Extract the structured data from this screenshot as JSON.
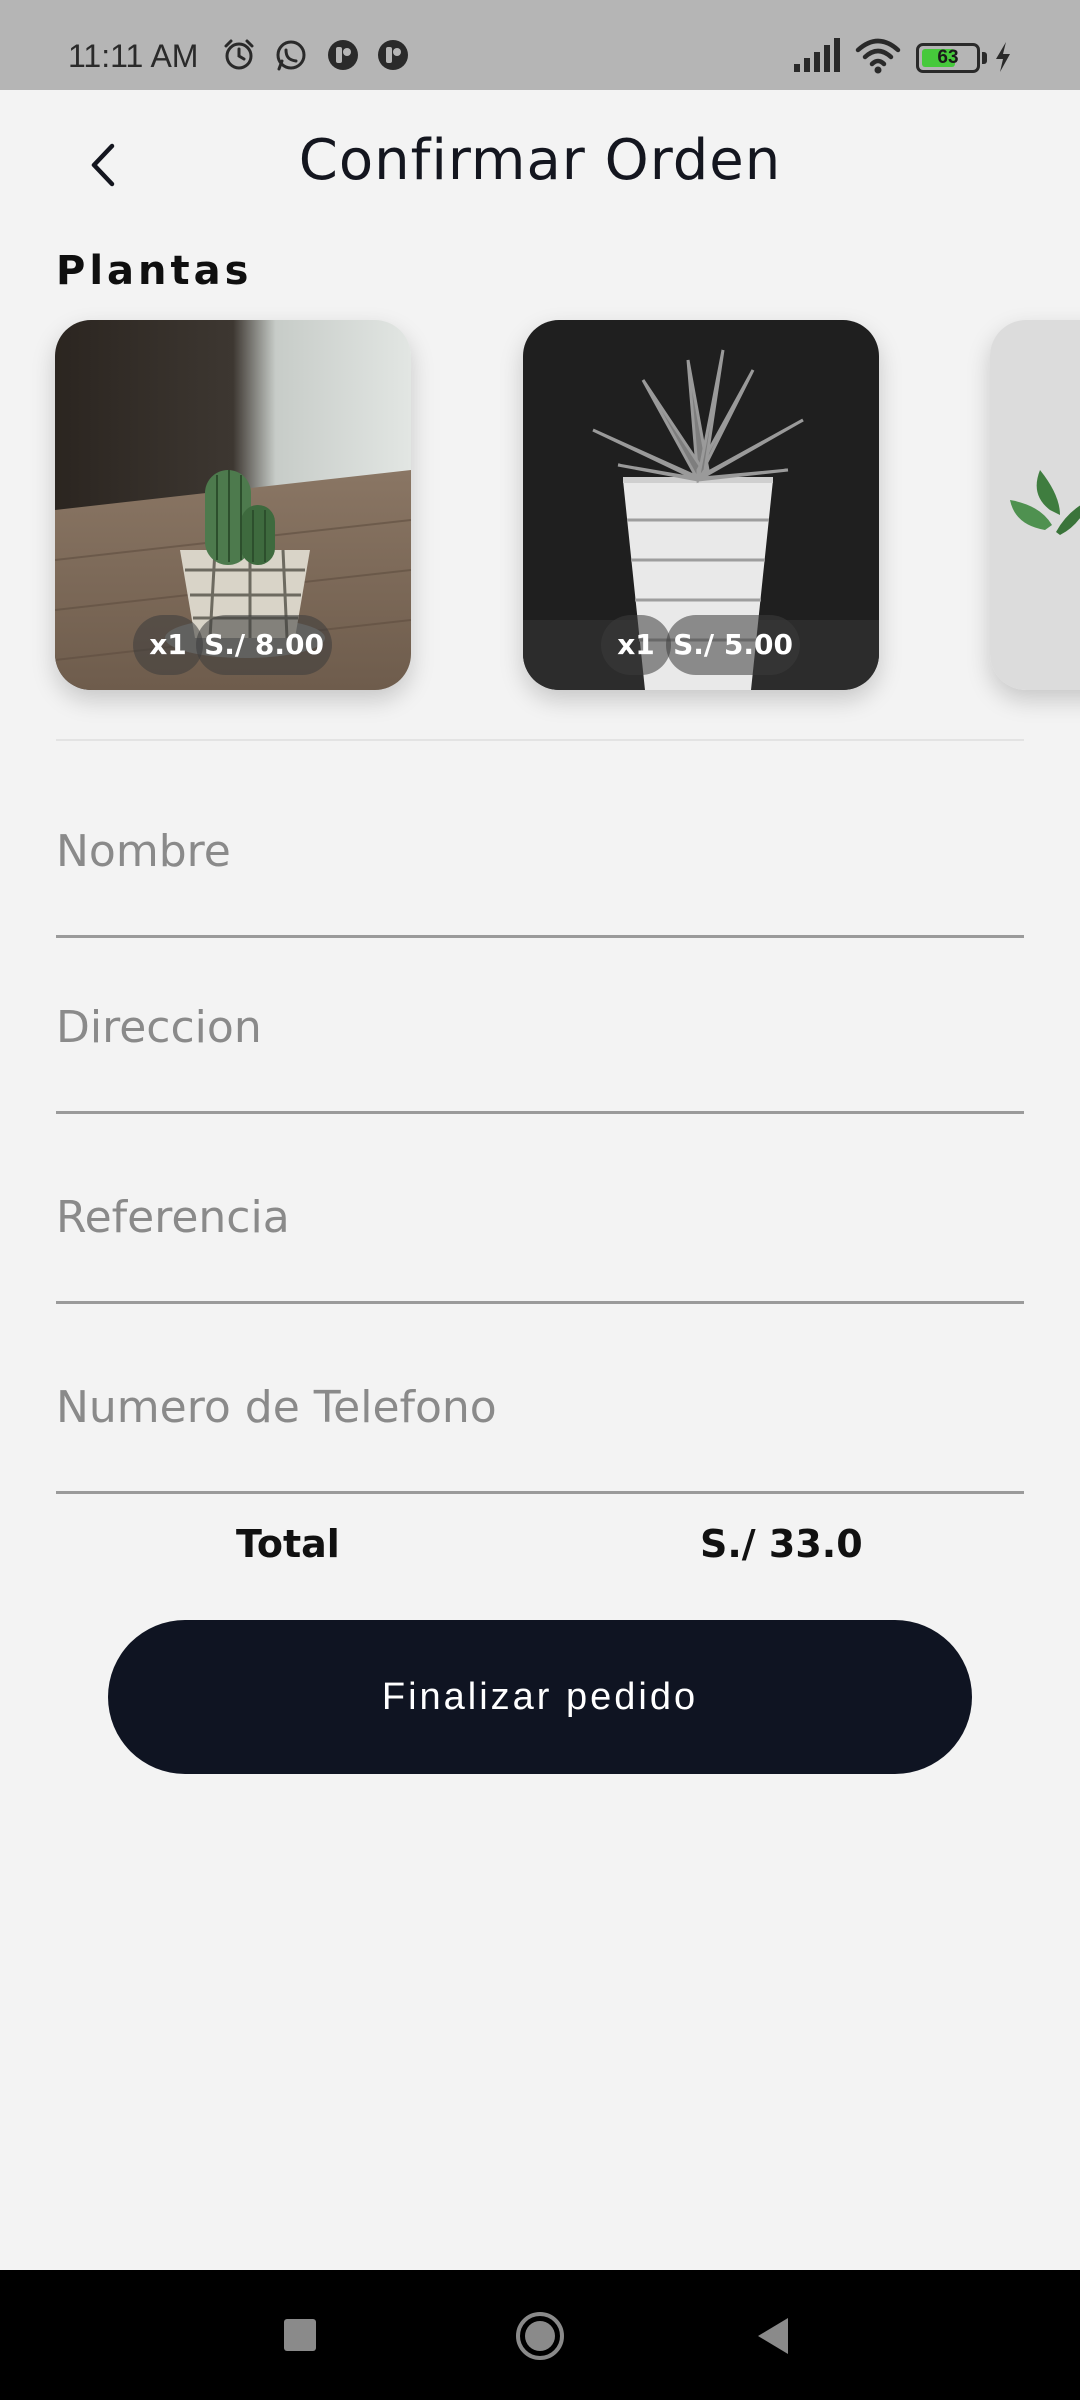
{
  "status_bar": {
    "time": "11:11 AM",
    "left_icons": [
      "alarm-icon",
      "whatsapp-icon",
      "app-notification-icon",
      "app-notification-icon"
    ],
    "right_icons": [
      "signal-icon",
      "wifi-icon",
      "battery-icon",
      "charging-icon"
    ],
    "battery_level": "63",
    "battery_color": "#46c93b"
  },
  "header": {
    "title": "Confirmar Orden",
    "back_icon": "chevron-left-icon"
  },
  "plants": {
    "section_title": "Plantas",
    "items": [
      {
        "quantity": "x1",
        "price": "S./ 8.00"
      },
      {
        "quantity": "x1",
        "price": "S./ 5.00"
      },
      {
        "quantity": "",
        "price": ""
      }
    ]
  },
  "form": {
    "fields": [
      {
        "placeholder": "Nombre"
      },
      {
        "placeholder": "Direccion"
      },
      {
        "placeholder": "Referencia"
      },
      {
        "placeholder": "Numero de Telefono"
      }
    ]
  },
  "summary": {
    "total_label": "Total",
    "total_value": "S./ 33.0"
  },
  "actions": {
    "submit_label": "Finalizar pedido",
    "accent_color": "#0f1422"
  },
  "nav_bar": {
    "buttons": [
      "recents-icon",
      "home-icon",
      "back-icon"
    ]
  }
}
